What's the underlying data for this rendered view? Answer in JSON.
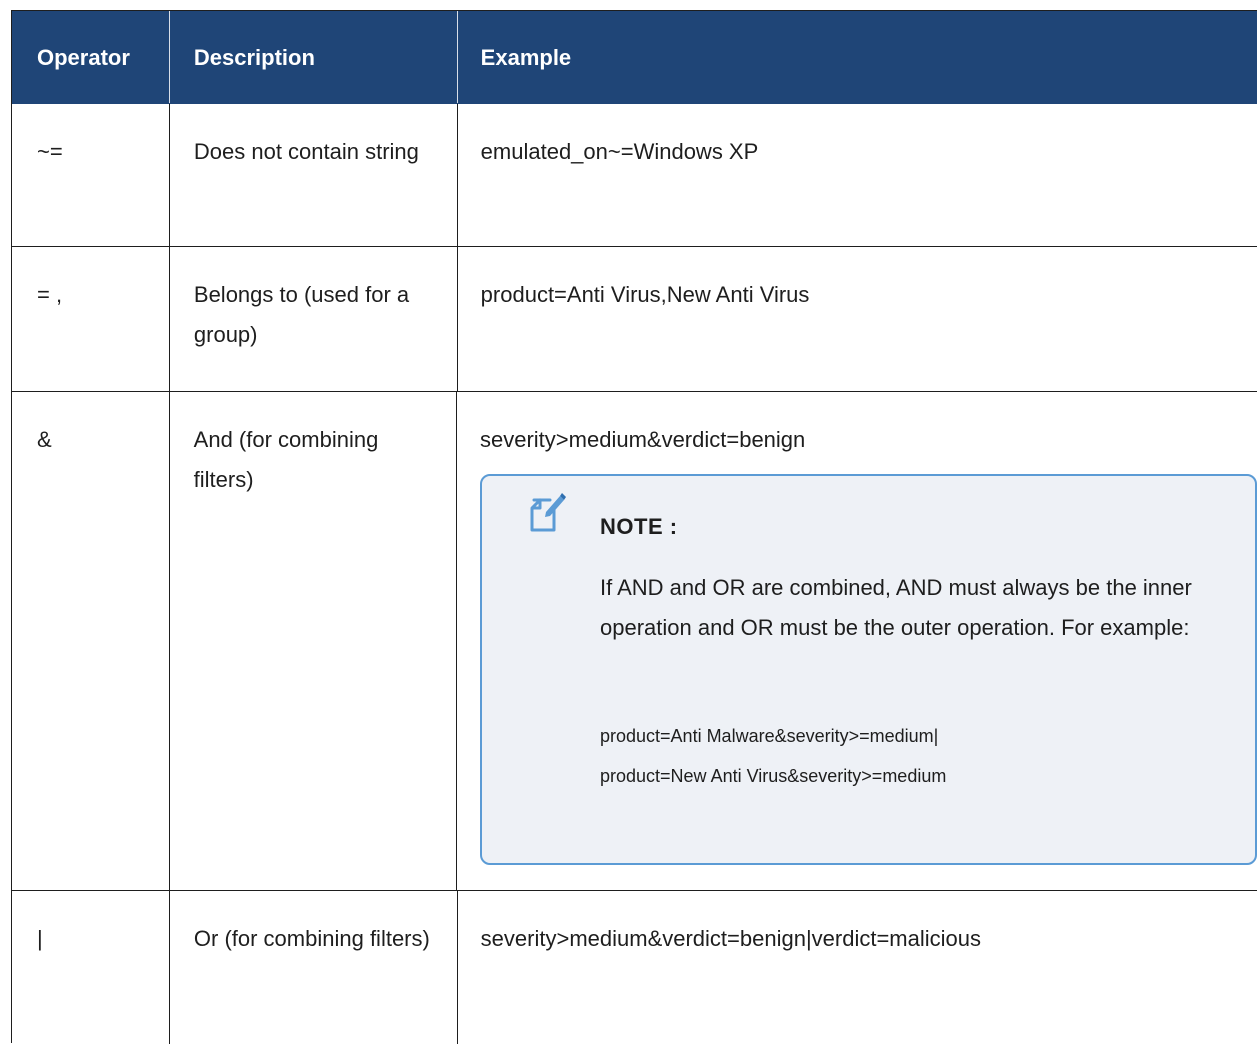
{
  "header": {
    "operator": "Operator",
    "description": "Description",
    "example": "Example"
  },
  "rows": [
    {
      "operator": "~=",
      "description": "Does not contain string",
      "example": "emulated_on~=Windows XP"
    },
    {
      "operator": "= ,",
      "description": "Belongs to (used for a group)",
      "example": "product=Anti Virus,New Anti Virus"
    },
    {
      "operator": "&",
      "description": "And (for combining filters)",
      "example": "severity>medium&verdict=benign"
    },
    {
      "operator": "|",
      "description": "Or (for combining filters)",
      "example": "severity>medium&verdict=benign|verdict=malicious"
    }
  ],
  "note": {
    "icon": "note-pencil-icon",
    "title": "NOTE :",
    "body": "If AND and OR are combined, AND must always be the inner operation and OR must be the outer operation. For example:",
    "code_line_1": "product=Anti Malware&severity>=medium|",
    "code_line_2": "product=New Anti Virus&severity>=medium"
  },
  "colors": {
    "header_bg": "#1f4577",
    "note_bg": "#eef1f6",
    "note_border": "#5b9bd5"
  }
}
